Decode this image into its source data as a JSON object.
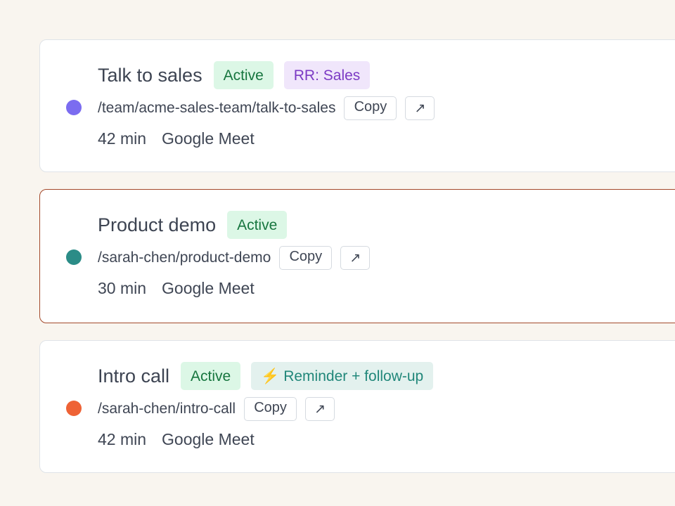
{
  "event_types": [
    {
      "title": "Talk to sales",
      "status": "Active",
      "extra_badge": "RR: Sales",
      "extra_badge_kind": "round-robin",
      "path": "/team/acme-sales-team/talk-to-sales",
      "copy_label": "Copy",
      "open_label": "↗",
      "duration": "42 min",
      "location": "Google Meet",
      "color": "#7b6cf0",
      "selected": false
    },
    {
      "title": "Product demo",
      "status": "Active",
      "extra_badge": "",
      "extra_badge_kind": "",
      "path": "/sarah-chen/product-demo",
      "copy_label": "Copy",
      "open_label": "↗",
      "duration": "30 min",
      "location": "Google Meet",
      "color": "#2b8c87",
      "selected": true
    },
    {
      "title": "Intro call",
      "status": "Active",
      "extra_badge": "⚡ Reminder + follow-up",
      "extra_badge_kind": "workflow",
      "path": "/sarah-chen/intro-call",
      "copy_label": "Copy",
      "open_label": "↗",
      "duration": "42 min",
      "location": "Google Meet",
      "color": "#ee6235",
      "selected": false
    }
  ],
  "colors": {
    "background": "#f9f5ef",
    "selected_border": "#a3482a",
    "active_badge_bg": "#dcf7e6",
    "active_badge_text": "#17763f"
  }
}
